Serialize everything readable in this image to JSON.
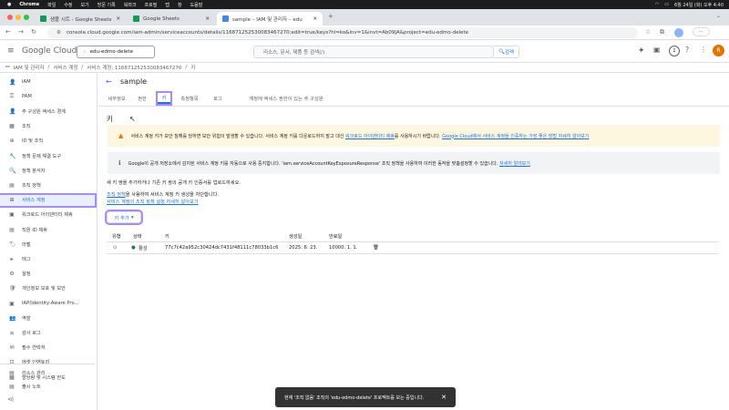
{
  "mac_menu": {
    "app": "Chrome",
    "items": [
      "파일",
      "수정",
      "보기",
      "방문 기록",
      "북마크",
      "프로필",
      "탭",
      "창",
      "도움말"
    ],
    "datetime": "6월 24일 (화) 오후 4:40"
  },
  "browser": {
    "tabs": [
      {
        "label": "샘플 시트 - Google Sheets",
        "color": "#0f9d58"
      },
      {
        "label": "Google Sheets",
        "color": "#0f9d58"
      },
      {
        "label": "sample – IAM 및 관리자 – edu",
        "color": "#4285f4"
      }
    ],
    "url": "console.cloud.google.com/iam-admin/serviceaccounts/details/116871252530083467270;edit=true/keys?hl=ko&inv=1&invt=Ab09JA&project=edu-edmo-delete"
  },
  "header": {
    "brand_google": "Google",
    "brand_cloud": "Cloud",
    "project": "edu-edmo-delete",
    "search_placeholder": "리소스, 문서, 제품 등 검색(/)",
    "search_button": "검색",
    "notif_count": "1",
    "avatar_letter": "R"
  },
  "breadcrumb": [
    "IAM 및 관리자",
    "서비스 계정",
    "서비스 계정: 116871252530083467270",
    "키"
  ],
  "sidebar": {
    "items": [
      {
        "icon": "👤",
        "label": "IAM"
      },
      {
        "icon": "⚿",
        "label": "PAM"
      },
      {
        "icon": "👤",
        "label": "주 구성원 액세스 경계"
      },
      {
        "icon": "▦",
        "label": "조직"
      },
      {
        "icon": "⊕",
        "label": "ID 및 조직"
      },
      {
        "icon": "🔧",
        "label": "정책 문제 해결 도구"
      },
      {
        "icon": "🔍",
        "label": "정책 분석자"
      },
      {
        "icon": "▤",
        "label": "조직 정책"
      },
      {
        "icon": "⊞",
        "label": "서비스 계정"
      },
      {
        "icon": "▣",
        "label": "워크로드 아이덴티티 제휴"
      },
      {
        "icon": "▤",
        "label": "직원 ID 제휴"
      },
      {
        "icon": "🏷",
        "label": "라벨"
      },
      {
        "icon": "▸",
        "label": "태그"
      },
      {
        "icon": "⚙",
        "label": "설정"
      },
      {
        "icon": "🛡",
        "label": "개인정보 보호 및 보안"
      },
      {
        "icon": "▣",
        "label": "IAP(Identity-Aware Pro..."
      },
      {
        "icon": "👥",
        "label": "역할"
      },
      {
        "icon": "≡",
        "label": "감사 로그"
      },
      {
        "icon": "✉",
        "label": "필수 연락처"
      },
      {
        "icon": "⊡",
        "label": "애셋 인벤토리"
      },
      {
        "icon": "▦",
        "label": "할당량 및 시스템 한도"
      }
    ],
    "bottom_items": [
      {
        "icon": "▤",
        "label": "리소스 관리"
      },
      {
        "icon": "▤",
        "label": "출시 노트"
      }
    ],
    "collapse": "⊲|"
  },
  "page": {
    "title": "sample",
    "tabs": [
      "세부정보",
      "권한",
      "키",
      "측정항목",
      "로그",
      "계정에 액세스 권한이 있는 주 구성원"
    ],
    "section_title": "키",
    "warning": {
      "text": "서비스 계정 키가 보안 침해를 당하면 보안 위험이 발생할 수 있습니다. 서비스 계정 키를 다운로드하지 말고 대신 ",
      "link1": "워크로드 아이덴티티 제휴",
      "mid": "를 사용하시기 바랍니다. ",
      "link2": "Google Cloud에서 서비스 계정을 인증하는 가장 좋은 방법 자세히 알아보기"
    },
    "info": {
      "text": "Google이 공개 저장소에서 감지된 서비스 계정 키를 자동으로 사용 중지합니다. 'iam.serviceAccountKeyExposureResponse' 조직 정책을 사용하여 이러한 동작을 맞춤설정할 수 있습니다. ",
      "link": "자세히 알아보기"
    },
    "desc": "새 키 쌍을 추가하거나 기존 키 쌍의 공개 키 인증서를 업로드하세요.",
    "policy_prefix_link": "조직 정책",
    "policy_text": "을 사용하여 서비스 계정 키 생성을 차단합니다.",
    "policy_learn_link": "서비스 계정의 조직 정책 설정 자세히 알아보기",
    "add_key_button": "키 추가",
    "table": {
      "headers": [
        "유형",
        "상태",
        "키",
        "생성일",
        "만료일"
      ],
      "rows": [
        {
          "status": "활성",
          "key": "77c7c42a952c30424dc7431f48111c78033b1c6",
          "created": "2025. 6. 23.",
          "expires": "10000. 1. 1."
        }
      ]
    }
  },
  "toast": {
    "text": "현재 '조직 없음' 조직의 'edu-edmo-delete' 프로젝트를 보는 중입니다.",
    "close": "✕"
  },
  "colors": {
    "accent": "#1a73e8",
    "highlight": "#a78bfa",
    "warning_bg": "#fef7e0",
    "active_green": "#188038"
  }
}
